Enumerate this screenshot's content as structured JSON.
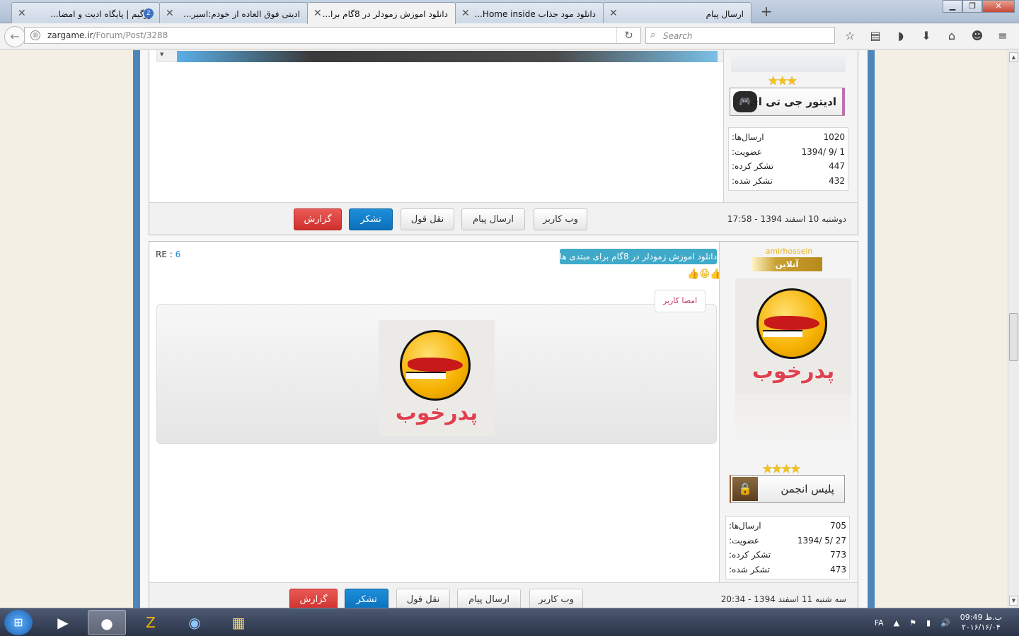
{
  "browser": {
    "tabs": [
      {
        "label": "ارسال پیام"
      },
      {
        "label": "دانلود مود جذاب Home inside..."
      },
      {
        "label": "دانلود اموزش زمودلر در 8گام برا..."
      },
      {
        "label": "ادیتی فوق العاده از خودم:اسیر..."
      },
      {
        "label": "زرگیم | پایگاه ادیت و امضا..."
      }
    ],
    "url_domain": "zargame.ir",
    "url_path": "/Forum/Post/3288",
    "search_placeholder": "Search"
  },
  "post1": {
    "rank_label": "ادیتور جی تی ای",
    "stats": [
      {
        "label": "ارسال‌ها:",
        "value": "1020"
      },
      {
        "label": "عضویت:",
        "value": "1394/ 9/ 1"
      },
      {
        "label": "تشکر کرده:",
        "value": "447"
      },
      {
        "label": "تشکر شده:",
        "value": "432"
      }
    ],
    "date": "دوشنبه 10 اسفند 1394 - 17:58",
    "rating": 3
  },
  "post2": {
    "username": "amirhossein",
    "online_label": "آنلاین",
    "re_label": "RE :",
    "re_number": "6",
    "title_badge": "دانلود اموزش زمودلر در 8گام برای مبتدی ها",
    "signature_label": "امضا کاربر",
    "logo_text": "پدرخوب",
    "rank_label": "پلیس انجمن",
    "stats": [
      {
        "label": "ارسال‌ها:",
        "value": "705"
      },
      {
        "label": "عضویت:",
        "value": "1394/ 5/ 27"
      },
      {
        "label": "تشکر کرده:",
        "value": "773"
      },
      {
        "label": "تشکر شده:",
        "value": "473"
      }
    ],
    "date": "سه شنبه 11 اسفند 1394 - 20:34",
    "rating": 4
  },
  "actions": {
    "web": "وب کاربر",
    "message": "ارسال پیام",
    "quote": "نقل قول",
    "thanks": "تشکر",
    "report": "گزارش"
  },
  "taskbar": {
    "lang": "FA",
    "time": "09:49 ب.ظ",
    "date": "۲۰۱۶/۱۶/۰۴"
  }
}
